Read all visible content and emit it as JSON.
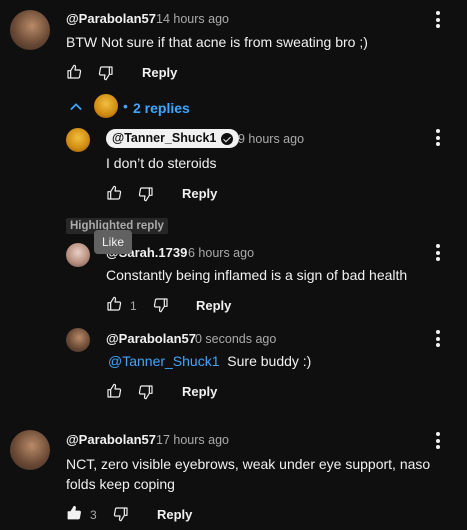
{
  "comments": [
    {
      "author": "@Parabolan57",
      "time": "14 hours ago",
      "text": "BTW Not sure if that acne is from sweating bro ;)",
      "like_count": "",
      "reply_label": "Reply",
      "replies_toggle": {
        "label": "2 replies"
      },
      "replies": [
        {
          "author": "@Tanner_Shuck1",
          "author_is_creator": true,
          "time": "9 hours ago",
          "text": "I don’t do steroids",
          "like_count": "",
          "reply_label": "Reply"
        },
        {
          "highlight_label": "Highlighted reply",
          "tooltip": "Like",
          "author": "@Sarah.1739",
          "time": "6 hours ago",
          "text": "Constantly being inflamed is a sign of bad health",
          "like_count": "1",
          "reply_label": "Reply"
        },
        {
          "author": "@Parabolan57",
          "time": "0 seconds ago",
          "mention": "@Tanner_Shuck1",
          "text": "Sure buddy :)",
          "like_count": "",
          "reply_label": "Reply"
        }
      ]
    },
    {
      "author": "@Parabolan57",
      "time": "17 hours ago",
      "text": "NCT, zero visible eyebrows, weak under eye support, naso folds keep coping",
      "like_count": "3",
      "liked": true,
      "reply_label": "Reply"
    }
  ],
  "colors": {
    "background": "#0f0f0f",
    "text": "#f1f1f1",
    "secondary_text": "#aaaaaa",
    "link": "#3ea6ff"
  }
}
